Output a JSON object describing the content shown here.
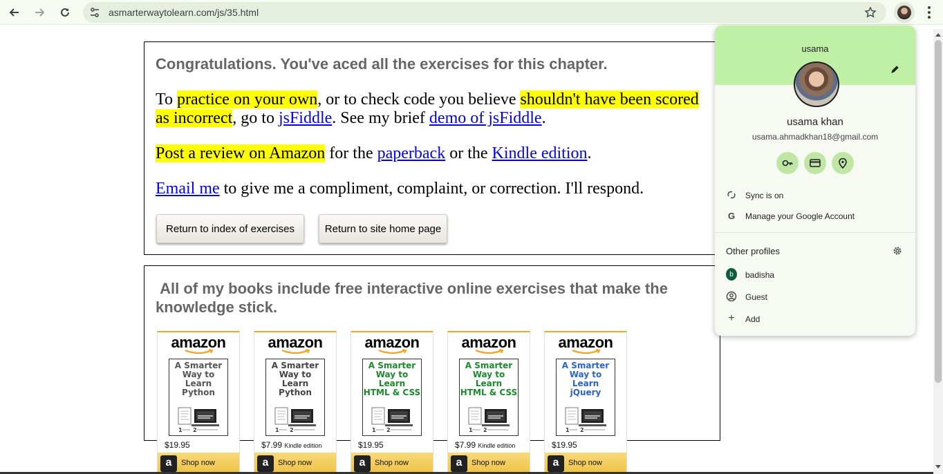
{
  "browser": {
    "url": "asmarterwaytolearn.com/js/35.html"
  },
  "content": {
    "congrats": "Congratulations. You've aced all the exercises for this chapter.",
    "para1": {
      "t1": "To ",
      "h1": "practice on your own",
      "t2": ", or to check code you believe ",
      "h2": "shouldn't have been scored as incorrect",
      "t3": ", go to ",
      "link1": "jsFiddle",
      "t4": ". See my brief ",
      "link2": "demo of jsFiddle",
      "t5": "."
    },
    "para2": {
      "h1": "Post a review on Amazon",
      "t1": " for the ",
      "link1": "paperback",
      "t2": " or the ",
      "link2": "Kindle edition",
      "t3": "."
    },
    "para3": {
      "link1": "Email me",
      "t1": " to give me a compliment, complaint, or correction. I'll respond."
    },
    "buttons": {
      "index": "Return to index of exercises",
      "home": "Return to site home page"
    },
    "books_heading": "All of my books include free interactive online exercises that make the knowledge stick."
  },
  "books": [
    {
      "logo": "amazon",
      "title_lines": [
        "A Smarter",
        "Way to",
        "Learn",
        "Python"
      ],
      "title_color": "#555555",
      "price": "$19.95",
      "price_note": "",
      "shop": "Shop now",
      "badge": "a"
    },
    {
      "logo": "amazon",
      "title_lines": [
        "A Smarter",
        "Way to",
        "Learn",
        "Python"
      ],
      "title_color": "#444444",
      "price": "$7.99",
      "price_note": "Kindle edition",
      "shop": "Shop now",
      "badge": "a"
    },
    {
      "logo": "amazon",
      "title_lines": [
        "A Smarter",
        "Way to",
        "Learn",
        "HTML & CSS"
      ],
      "title_color": "#1a8a2a",
      "price": "$19.95",
      "price_note": "",
      "shop": "Shop now",
      "badge": "a"
    },
    {
      "logo": "amazon",
      "title_lines": [
        "A Smarter",
        "Way to",
        "Learn",
        "HTML & CSS"
      ],
      "title_color": "#1a8a2a",
      "price": "$7.99",
      "price_note": "Kindle edition",
      "shop": "Shop now",
      "badge": "a"
    },
    {
      "logo": "amazon",
      "title_lines": [
        "A Smarter",
        "Way to",
        "Learn",
        "jQuery"
      ],
      "title_color": "#2a64c8",
      "price": "$19.95",
      "price_note": "",
      "shop": "Shop now",
      "badge": "a"
    }
  ],
  "profile": {
    "name": "usama",
    "full_name": "usama khan",
    "email": "usama.ahmadkhan18@gmail.com",
    "sync": "Sync is on",
    "manage": "Manage your Google Account",
    "other_profiles": "Other profiles",
    "profiles": [
      {
        "label": "badisha",
        "initial": "b"
      },
      {
        "label": "Guest"
      },
      {
        "label": "Add"
      }
    ]
  },
  "colors": {
    "highlight": "#ffff00",
    "link": "#0000ee",
    "profile_header": "#bff0a6",
    "amazon_orange": "#f5a623"
  }
}
